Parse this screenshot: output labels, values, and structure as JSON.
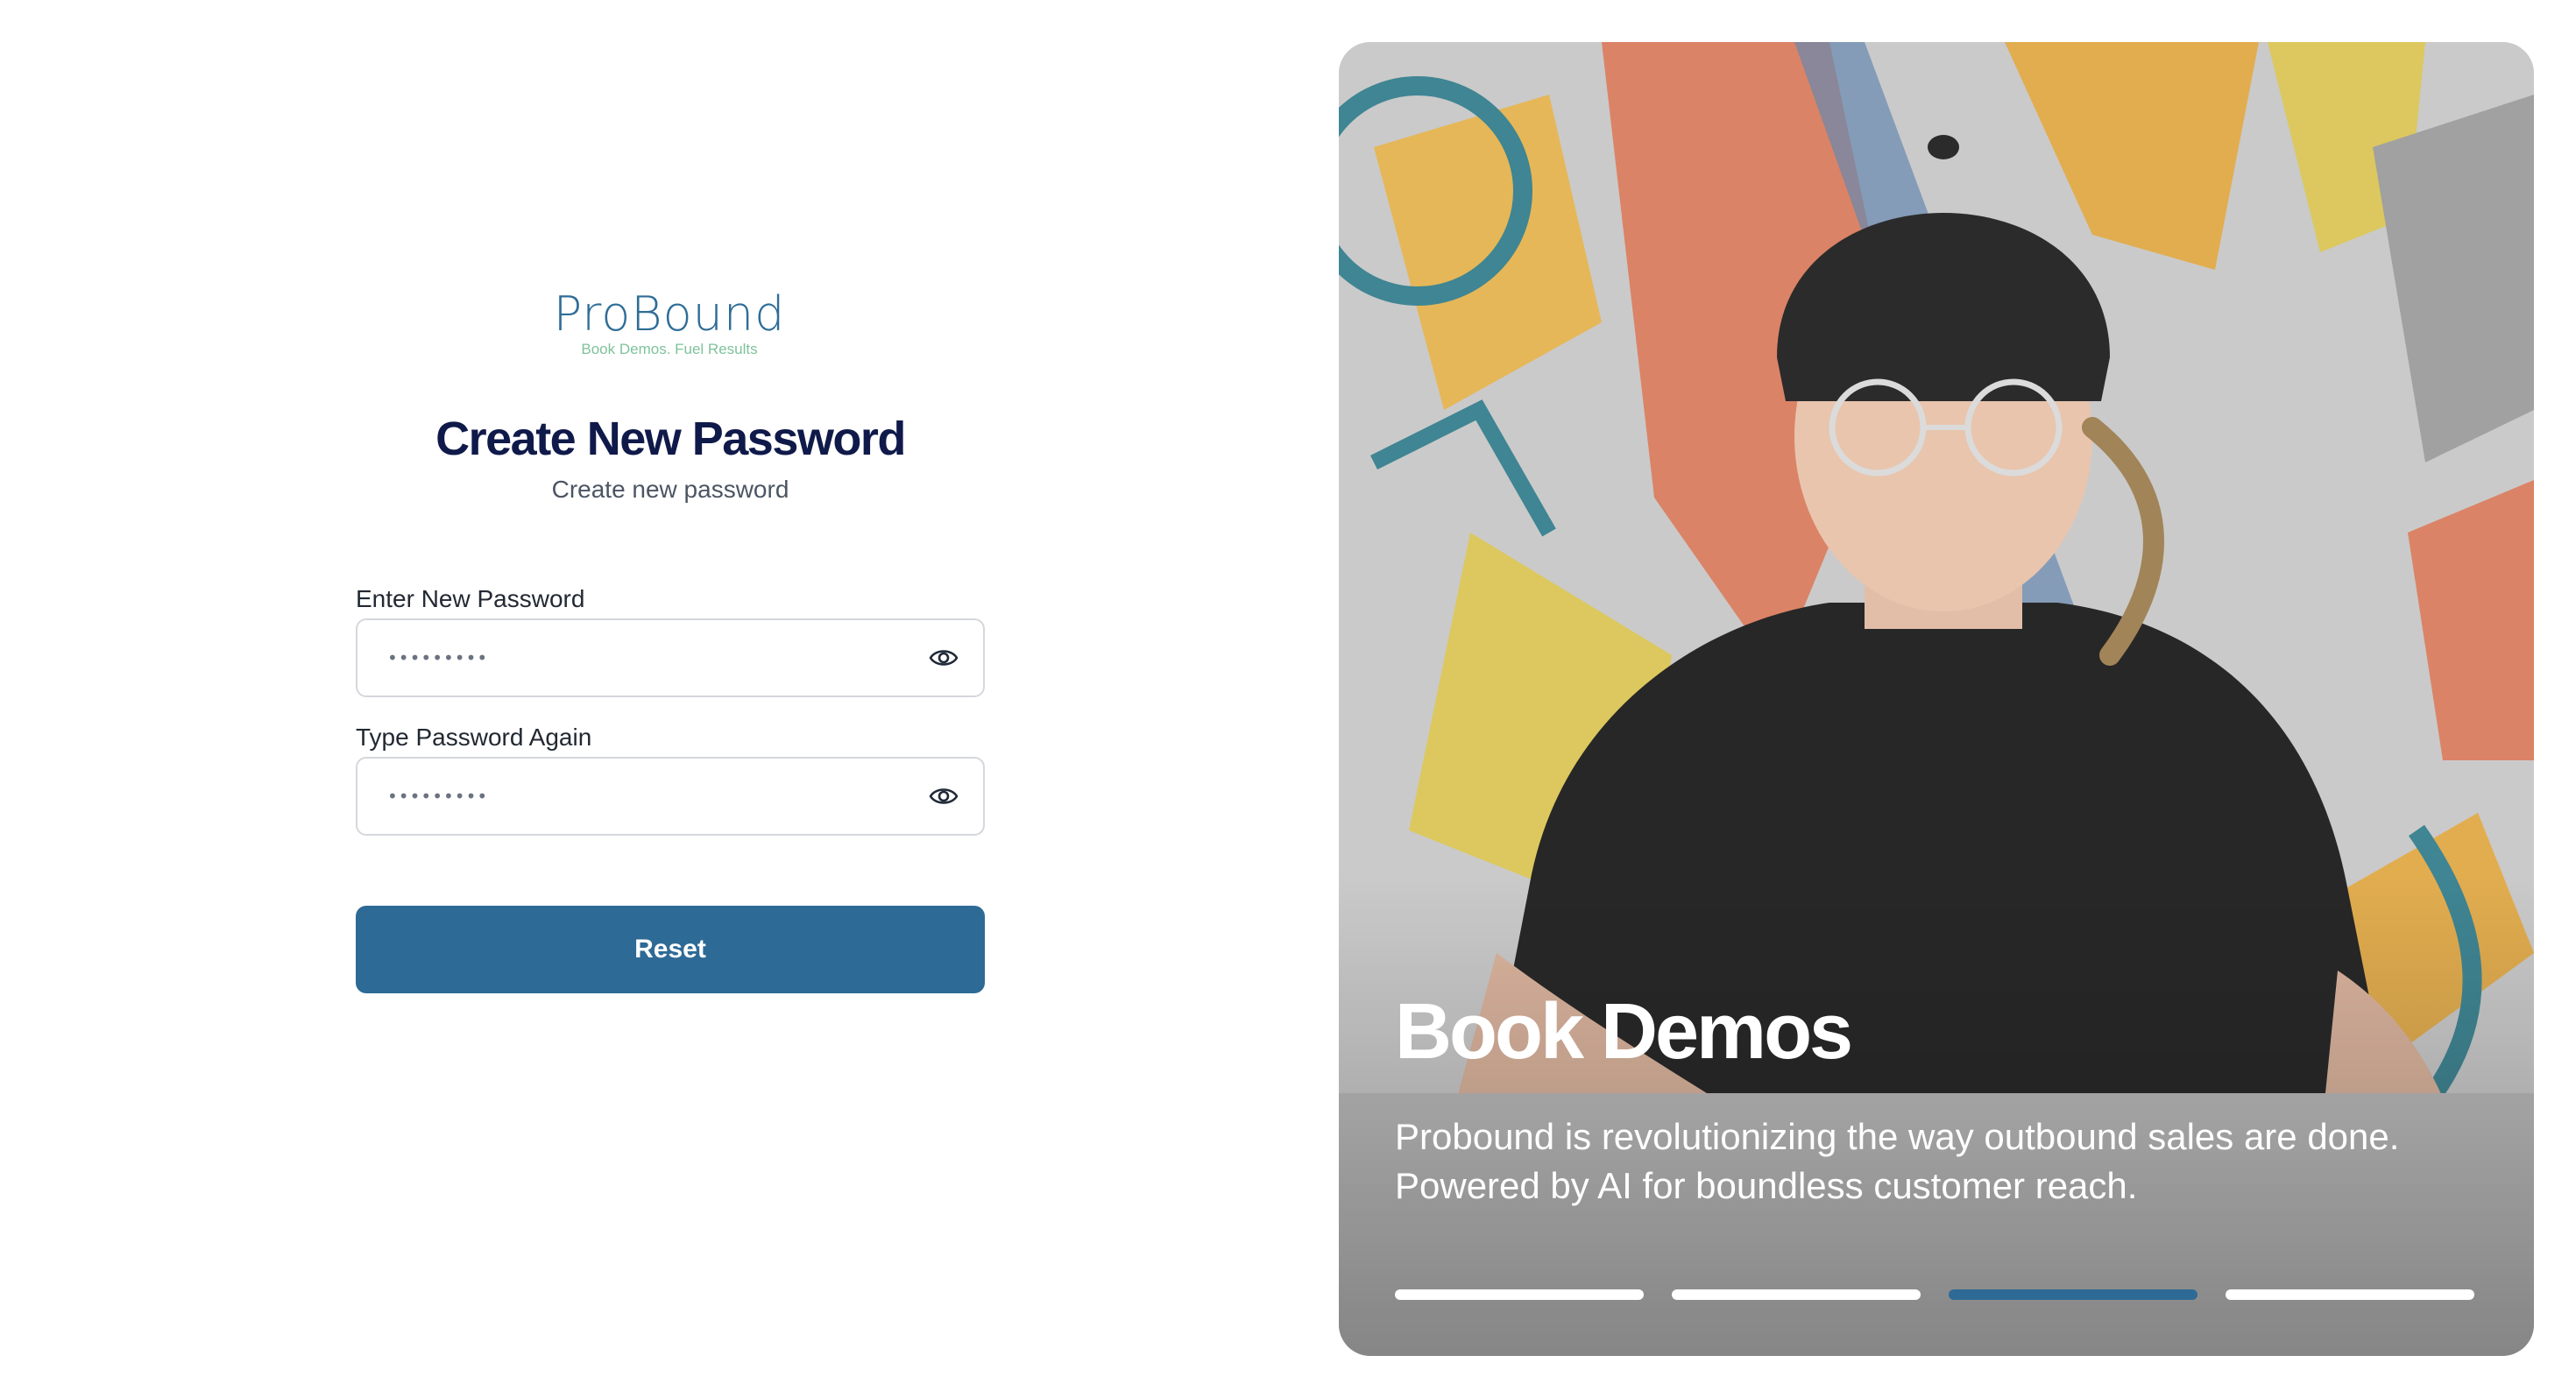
{
  "logo": {
    "wordmark": "ProBound",
    "tagline": "Book Demos. Fuel Results"
  },
  "form": {
    "title": "Create New Password",
    "subtitle": "Create new password",
    "new_password": {
      "label": "Enter New Password",
      "masked_value": "•••••••••"
    },
    "confirm_password": {
      "label": "Type Password Again",
      "masked_value": "•••••••••"
    },
    "submit_label": "Reset"
  },
  "hero": {
    "title": "Book Demos",
    "description": "Probound is revolutionizing the way outbound sales are done. Powered by AI for boundless customer reach.",
    "carousel": {
      "slide_count": 4,
      "active_index": 2
    }
  },
  "colors": {
    "brand_blue": "#2e6a96",
    "title_navy": "#0f1a4a",
    "tagline_green": "#7fc29b"
  },
  "icons": {
    "password_toggle": "eye-icon"
  }
}
